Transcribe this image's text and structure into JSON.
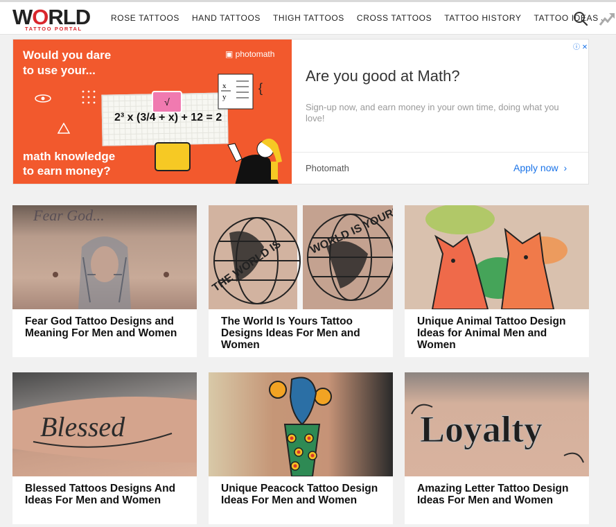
{
  "header": {
    "logo_word": "WORLD",
    "logo_sub": "TATTOO PORTAL",
    "nav": [
      "ROSE TATTOOS",
      "HAND TATTOOS",
      "THIGH TATTOOS",
      "CROSS TATTOOS",
      "TATTOO HISTORY",
      "TATTOO IDEAS"
    ],
    "icons": {
      "search": "search-icon",
      "trending": "trending-icon"
    }
  },
  "ad": {
    "image_headline": "Would you dare to use your...",
    "image_brand": "photomath",
    "equation": "2³ x (3/4 + x) + 12 = 2",
    "pink_key": "√",
    "image_footer": "math knowledge to earn money?",
    "headline": "Are you good at Math?",
    "description": "Sign-up now, and earn money in your own time, doing what you love!",
    "advertiser": "Photomath",
    "cta": "Apply now",
    "cta_icon": "chevron-right-icon",
    "choices_icons": "info-icon close-icon"
  },
  "cards": [
    {
      "title": "Fear God Tattoo Designs and Meaning For Men and Women"
    },
    {
      "title": "The World Is Yours Tattoo Designs Ideas For Men and Women"
    },
    {
      "title": "Unique Animal Tattoo Design Ideas for Animal Men and Women"
    },
    {
      "title": "Blessed Tattoos Designs And Ideas For Men and Women"
    },
    {
      "title": "Unique Peacock Tattoo Design Ideas For Men and Women"
    },
    {
      "title": "Amazing Letter Tattoo Design Ideas For Men and Women"
    }
  ],
  "colors": {
    "brand_red": "#d9262c",
    "ad_orange": "#f2592d",
    "link_blue": "#1a73e8"
  }
}
